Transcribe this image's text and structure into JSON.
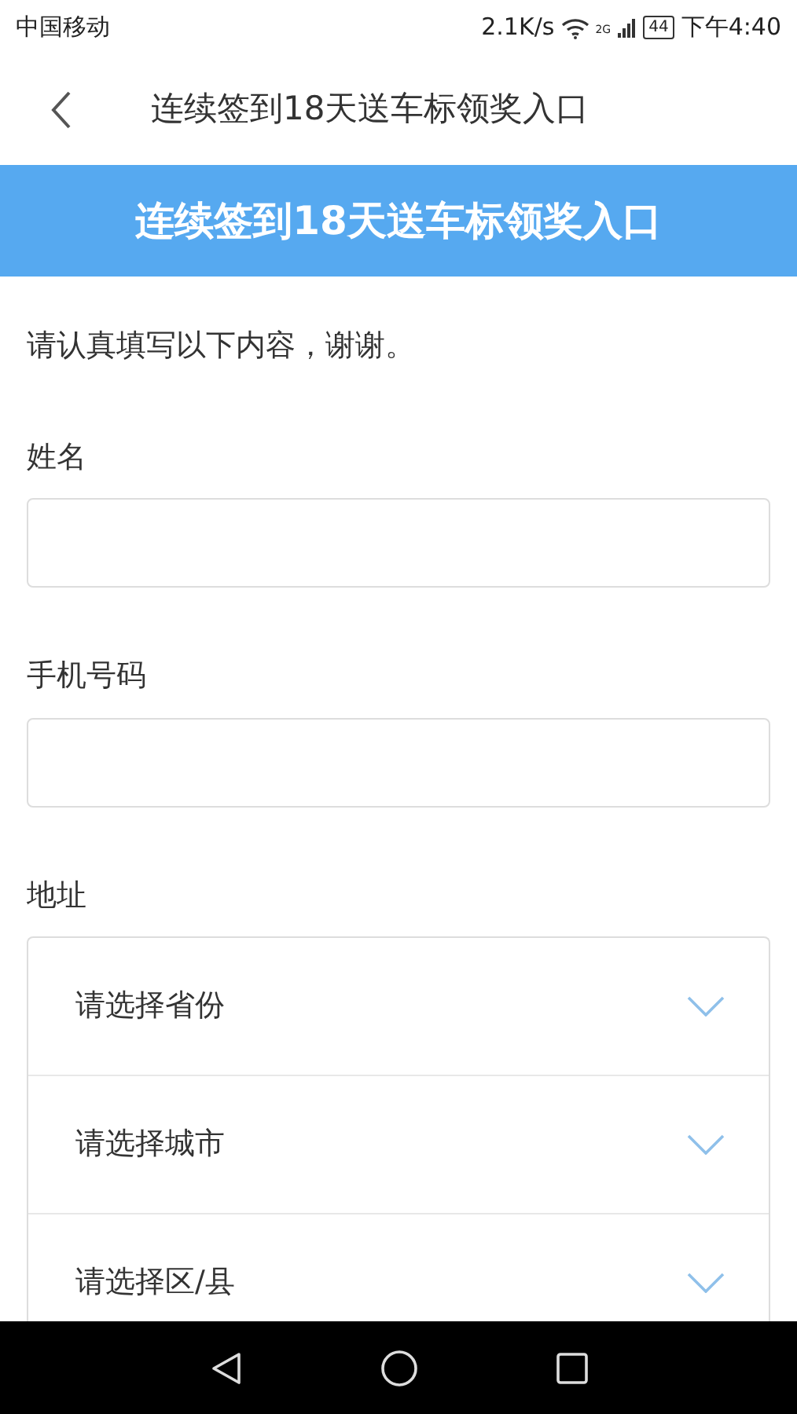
{
  "status_bar": {
    "carrier": "中国移动",
    "speed": "2.1K/s",
    "network": "2G",
    "battery": "44",
    "time": "下午4:40"
  },
  "header": {
    "title": "连续签到18天送车标领奖入口"
  },
  "banner": {
    "title": "连续签到18天送车标领奖入口"
  },
  "intro": "请认真填写以下内容，谢谢。",
  "fields": [
    {
      "label": "姓名"
    },
    {
      "label": "手机号码"
    }
  ],
  "address": {
    "label": "地址",
    "selects": [
      {
        "placeholder": "请选择省份"
      },
      {
        "placeholder": "请选择城市"
      },
      {
        "placeholder": "请选择区/县"
      }
    ]
  }
}
